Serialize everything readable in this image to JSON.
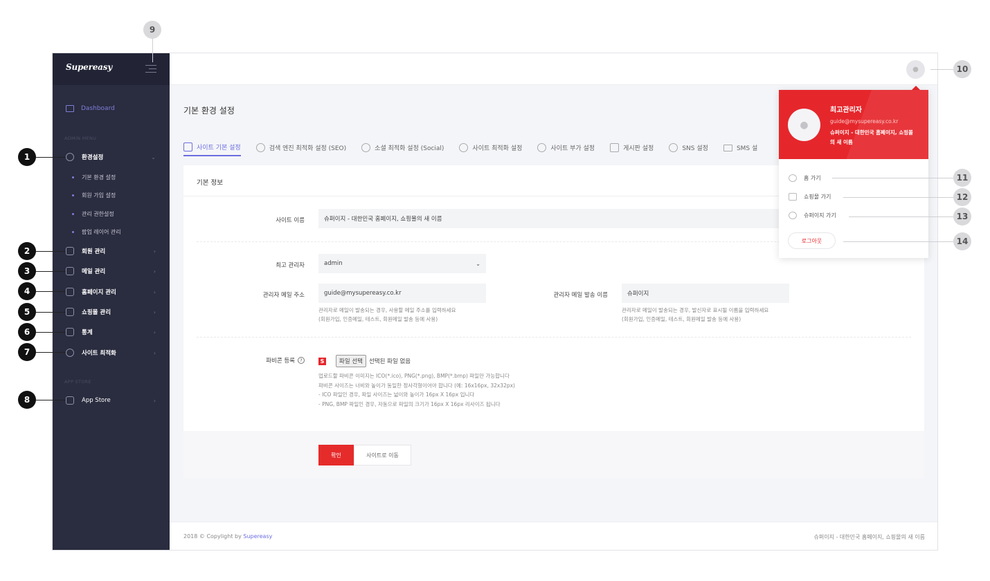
{
  "sidebar": {
    "logo": "Supereasy",
    "dashboard": "Dashboard",
    "admin_menu_label": "ADMIN MENU",
    "app_store_label": "APP STORE",
    "menu": [
      {
        "label": "환경설정",
        "icon": "gear-icon",
        "chevron": "⌄"
      },
      {
        "label": "회원 관리",
        "icon": "users-icon",
        "chevron": "›"
      },
      {
        "label": "메일 관리",
        "icon": "mail-icon",
        "chevron": "›"
      },
      {
        "label": "홈페이지 관리",
        "icon": "monitor-icon",
        "chevron": "›"
      },
      {
        "label": "쇼핑몰 관리",
        "icon": "bag-icon",
        "chevron": "›"
      },
      {
        "label": "통계",
        "icon": "chart-icon",
        "chevron": "›"
      },
      {
        "label": "사이트 최적화",
        "icon": "stopwatch-icon",
        "chevron": "›"
      }
    ],
    "submenu": [
      "기본 환경 설정",
      "회원 가입 설정",
      "관리 권한설정",
      "팝업 레이어 관리"
    ],
    "app_store": "App Store"
  },
  "page": {
    "title": "기본 환경 설정",
    "tabs": [
      "사이트 기본 설정",
      "검색 엔진 최적화 설정 (SEO)",
      "소셜 최적화 설정 (Social)",
      "사이트 최적화 설정",
      "사이트 부가 설정",
      "게시판 설정",
      "SNS 설정",
      "SMS 설"
    ]
  },
  "form": {
    "section_title": "기본 정보",
    "site_name_label": "사이트 이름",
    "site_name_value": "슈퍼이지 - 대한민국 홈페이지, 쇼핑몰의 새 이름",
    "admin_label": "최고 관리자",
    "admin_value": "admin",
    "admin_email_label": "관리자 메일 주소",
    "admin_email_value": "guide@mysupereasy.co.kr",
    "admin_email_help1": "관리자로 메일이 발송되는 경우, 사용할 메일 주소를 입력하세요",
    "admin_email_help2": "(회원가입, 인증메일, 테스트, 회원메일 발송 등에 사용)",
    "sender_name_label": "관리자 메일 발송 이름",
    "sender_name_value": "슈퍼이지",
    "sender_help1": "관리자로 메일이 발송되는 경우, 발신자로 표시될 이름을 입력하세요",
    "sender_help2": "(회원가입, 인증메일, 테스트, 회원메일 발송 등에 사용)",
    "favicon_label": "파비콘 등록",
    "file_button": "파일 선택",
    "file_status": "선택된 파일 없음",
    "favicon_help": [
      "업로드할 파비콘 이미지는 ICO(*.ico), PNG(*.png), BMP(*.bmp) 파일만 가능합니다",
      "파비콘 사이즈는 너비와 높이가 동일한 정사각형이어야 합니다 (예: 16x16px, 32x32px)",
      "- ICO 파일인 경우, 파일 사이즈는 넓이와 높이가 16px X 16px 입니다",
      "- PNG, BMP 파일인 경우, 자동으로 파일의 크기가 16px X 16px 리사이즈 됩니다"
    ],
    "confirm": "확인",
    "go_site": "사이트로 이동"
  },
  "footer": {
    "copyright": "2018 © Copylight by ",
    "brand": "Supereasy",
    "right": "슈퍼이지 - 대한민국 홈페이지, 쇼핑몰의 새 이름"
  },
  "profile": {
    "name": "최고관리자",
    "email": "guide@mysupereasy.co.kr",
    "site": "슈퍼이지 - 대한민국 홈페이지, 쇼핑몰의 새 이름",
    "links": [
      "홈 가기",
      "쇼핑몰 가기",
      "슈퍼이지 가기"
    ],
    "logout": "로그아웃"
  },
  "callouts": [
    "1",
    "2",
    "3",
    "4",
    "5",
    "6",
    "7",
    "8",
    "9",
    "10",
    "11",
    "12",
    "13",
    "14"
  ],
  "colors": {
    "accent": "#e5272c",
    "primary": "#6b6de0",
    "sidebar": "#2a2c3f"
  }
}
